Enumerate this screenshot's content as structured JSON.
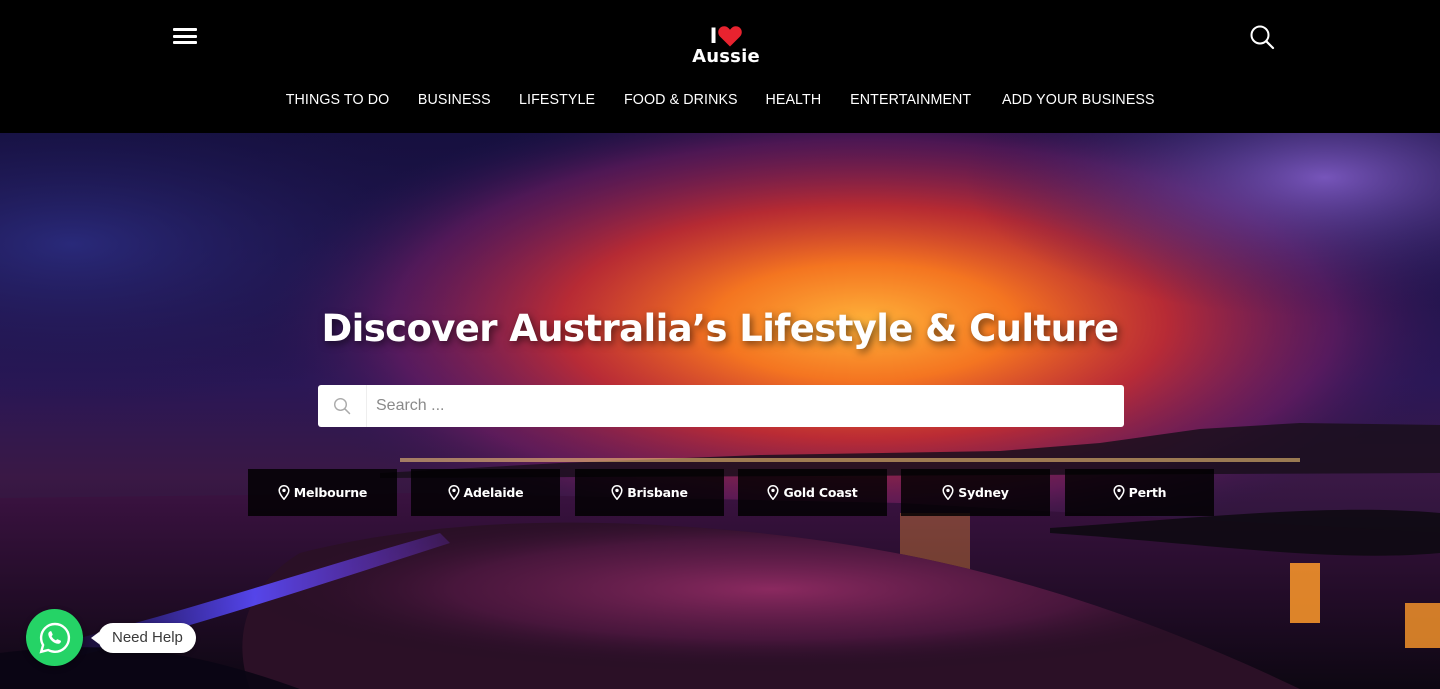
{
  "header": {
    "logo": {
      "line1": "I",
      "line2": "Aussie",
      "heart_color": "#e8232f"
    },
    "menu_icon": "hamburger-menu-icon",
    "search_icon": "search-icon"
  },
  "nav": {
    "items": [
      {
        "label": "THINGS TO DO"
      },
      {
        "label": "BUSINESS"
      },
      {
        "label": "LIFESTYLE"
      },
      {
        "label": "FOOD & DRINKS"
      },
      {
        "label": "HEALTH"
      },
      {
        "label": "ENTERTAINMENT"
      },
      {
        "label": "ADD YOUR BUSINESS"
      }
    ]
  },
  "hero": {
    "title": "Discover Australia’s Lifestyle & Culture",
    "search": {
      "placeholder": "Search ...",
      "value": ""
    },
    "cities": [
      {
        "label": "Melbourne",
        "icon": "map-pin-icon"
      },
      {
        "label": "Adelaide",
        "icon": "map-pin-icon"
      },
      {
        "label": "Brisbane",
        "icon": "map-pin-icon"
      },
      {
        "label": "Gold Coast",
        "icon": "map-pin-icon"
      },
      {
        "label": "Sydney",
        "icon": "map-pin-icon"
      },
      {
        "label": "Perth",
        "icon": "map-pin-icon"
      }
    ]
  },
  "help": {
    "label": "Need Help",
    "icon": "whatsapp-icon",
    "color": "#25d366"
  },
  "colors": {
    "header_bg": "#000000",
    "accent": "#e8232f"
  }
}
